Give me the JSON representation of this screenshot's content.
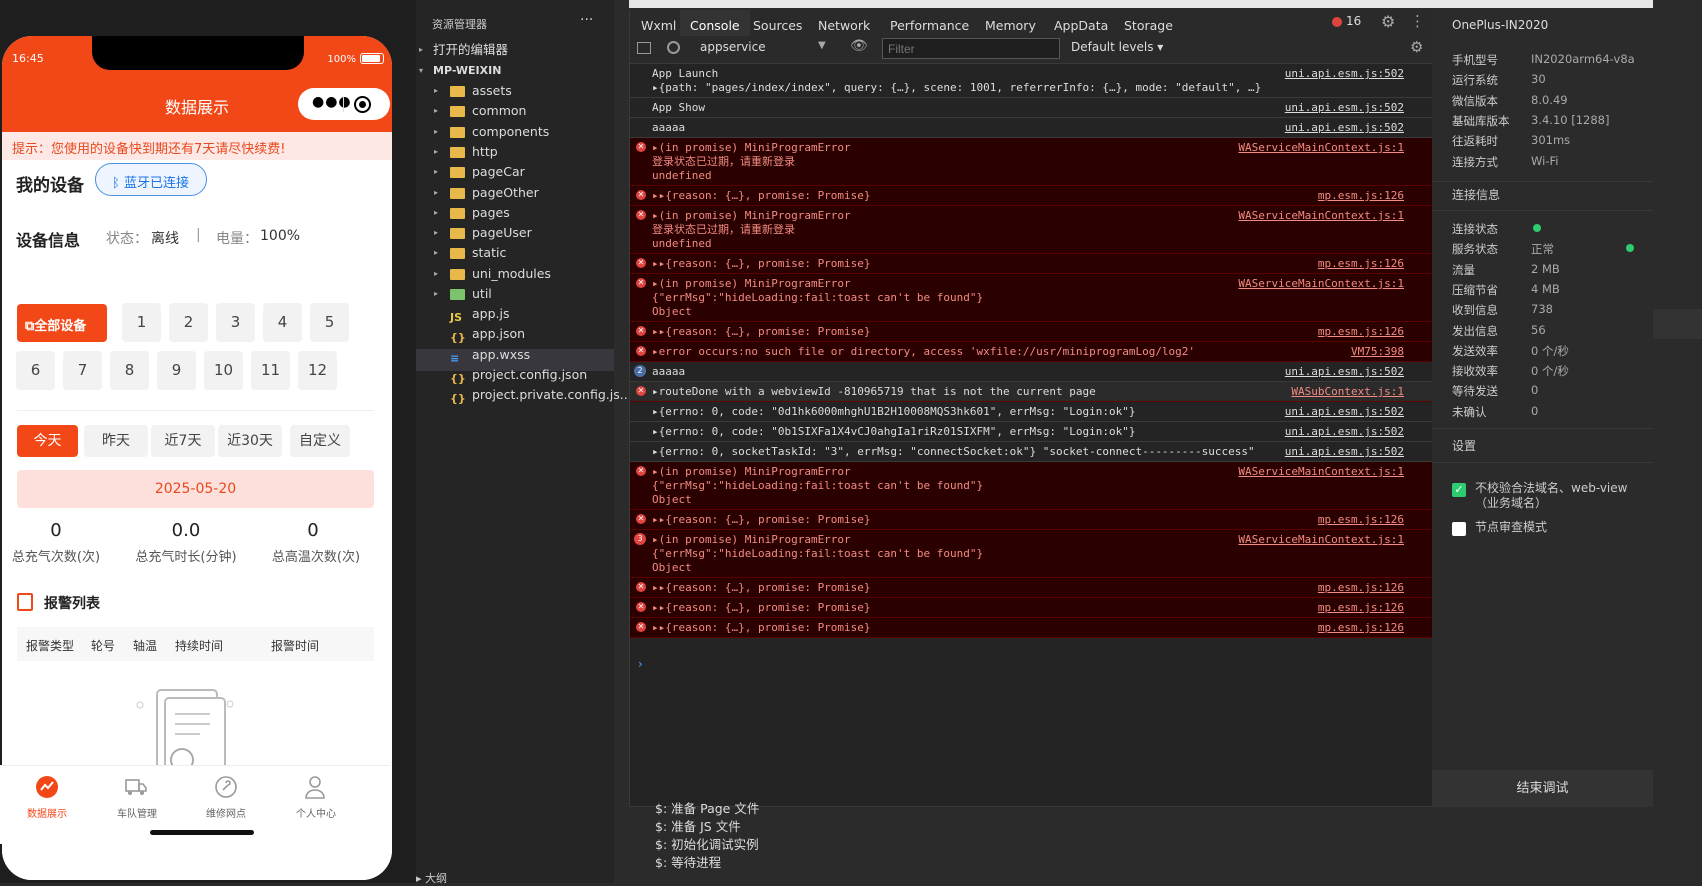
{
  "phone": {
    "time": "16:45",
    "battery": "100%",
    "title": "数据展示",
    "notice": "提示：您使用的设备快到期还有7天请尽快续费!",
    "my_devices": "我的设备",
    "bluetooth": "蓝牙已连接",
    "device_info": "设备信息",
    "status_label": "状态：",
    "status_value": "离线",
    "battery_label": "电量：",
    "battery_value": "100%",
    "all_devices": "全部设备",
    "device_numbers": [
      "1",
      "2",
      "3",
      "4",
      "5",
      "6",
      "7",
      "8",
      "9",
      "10",
      "11",
      "12"
    ],
    "ranges": [
      "今天",
      "昨天",
      "近7天",
      "近30天",
      "自定义"
    ],
    "date": "2025-05-20",
    "stats": [
      {
        "value": "0",
        "label": "总充气次数(次)"
      },
      {
        "value": "0.0",
        "label": "总充气时长(分钟)"
      },
      {
        "value": "0",
        "label": "总高温次数(次)"
      }
    ],
    "alarm_title": "报警列表",
    "alarm_cols": [
      "报警类型",
      "轮号",
      "轴温",
      "持续时间",
      "报警时间"
    ],
    "tabs": [
      "数据展示",
      "车队管理",
      "维修网点",
      "个人中心"
    ]
  },
  "explorer": {
    "title": "资源管理器",
    "more": "···",
    "open_editors": "打开的编辑器",
    "project": "MP-WEIXIN",
    "folders": [
      "assets",
      "common",
      "components",
      "http",
      "pageCar",
      "pageOther",
      "pages",
      "pageUser",
      "static",
      "uni_modules",
      "util"
    ],
    "files": [
      "app.js",
      "app.json",
      "app.wxss",
      "project.config.json",
      "project.private.config.js..."
    ],
    "bottom": "大纲"
  },
  "devtools": {
    "tabs": [
      "Wxml",
      "Console",
      "Sources",
      "Network",
      "Performance",
      "Memory",
      "AppData",
      "Storage"
    ],
    "error_count": "16",
    "context": "appservice",
    "filter_placeholder": "Filter",
    "levels": "Default levels",
    "rows": [
      {
        "type": "log",
        "msg": "App Launch\n▸{path: \"pages/index/index\", query: {…}, scene: 1001, referrerInfo: {…}, mode: \"default\", …}",
        "src": "uni.api.esm.js:502"
      },
      {
        "type": "log",
        "msg": "App Show",
        "src": "uni.api.esm.js:502"
      },
      {
        "type": "log",
        "msg": "aaaaa",
        "src": "uni.api.esm.js:502"
      },
      {
        "type": "err",
        "msg": "▸(in promise) MiniProgramError\n登录状态已过期，请重新登录\nundefined",
        "src": "WAServiceMainContext.js:1"
      },
      {
        "type": "err",
        "msg": "▸▸{reason: {…}, promise: Promise}",
        "src": "mp.esm.js:126"
      },
      {
        "type": "err",
        "msg": "▸(in promise) MiniProgramError\n登录状态已过期，请重新登录\nundefined",
        "src": "WAServiceMainContext.js:1"
      },
      {
        "type": "err",
        "msg": "▸▸{reason: {…}, promise: Promise}",
        "src": "mp.esm.js:126"
      },
      {
        "type": "err",
        "msg": "▸(in promise) MiniProgramError\n{\"errMsg\":\"hideLoading:fail:toast can't be found\"}\nObject",
        "src": "WAServiceMainContext.js:1"
      },
      {
        "type": "err",
        "msg": "▸▸{reason: {…}, promise: Promise}",
        "src": "mp.esm.js:126"
      },
      {
        "type": "err",
        "msg": "▸error occurs:no such file or directory, access 'wxfile://usr/miniprogramLog/log2'",
        "src": "VM75:398"
      },
      {
        "type": "log",
        "msg": "aaaaa",
        "src": "uni.api.esm.js:502",
        "count": "2"
      },
      {
        "type": "errlight",
        "msg": "▸routeDone with a webviewId -810965719 that is not the current page",
        "src": "WASubContext.js:1"
      },
      {
        "type": "log",
        "msg": "▸{errno: 0, code: \"0d1hk6000mhghU1B2H10008MQS3hk601\", errMsg: \"Login:ok\"}",
        "src": "uni.api.esm.js:502"
      },
      {
        "type": "log",
        "msg": "▸{errno: 0, code: \"0b1SIXFa1X4vCJ0ahgIa1riRz01SIXFM\", errMsg: \"Login:ok\"}",
        "src": "uni.api.esm.js:502"
      },
      {
        "type": "log",
        "msg": "▸{errno: 0, socketTaskId: \"3\", errMsg: \"connectSocket:ok\"} \"socket-connect---------success\"",
        "src": "uni.api.esm.js:502"
      },
      {
        "type": "err",
        "msg": "▸(in promise) MiniProgramError\n{\"errMsg\":\"hideLoading:fail:toast can't be found\"}\nObject",
        "src": "WAServiceMainContext.js:1"
      },
      {
        "type": "err",
        "msg": "▸▸{reason: {…}, promise: Promise}",
        "src": "mp.esm.js:126"
      },
      {
        "type": "err",
        "msg": "▸(in promise) MiniProgramError\n{\"errMsg\":\"hideLoading:fail:toast can't be found\"}\nObject",
        "src": "WAServiceMainContext.js:1",
        "count": "3"
      },
      {
        "type": "err",
        "msg": "▸▸{reason: {…}, promise: Promise}",
        "src": "mp.esm.js:126"
      },
      {
        "type": "err",
        "msg": "▸▸{reason: {…}, promise: Promise}",
        "src": "mp.esm.js:126"
      },
      {
        "type": "err",
        "msg": "▸▸{reason: {…}, promise: Promise}",
        "src": "mp.esm.js:126"
      }
    ],
    "prompt": "›"
  },
  "device_panel": {
    "name": "OnePlus-IN2020",
    "info": [
      {
        "k": "手机型号",
        "v": "IN2020arm64-v8a"
      },
      {
        "k": "运行系统",
        "v": "30"
      },
      {
        "k": "微信版本",
        "v": "8.0.49"
      },
      {
        "k": "基础库版本",
        "v": "3.4.10 [1288]"
      },
      {
        "k": "往返耗时",
        "v": "301ms"
      },
      {
        "k": "连接方式",
        "v": "Wi-Fi"
      }
    ],
    "conn_title": "连接信息",
    "conn": [
      {
        "k": "连接状态",
        "v": ""
      },
      {
        "k": "服务状态",
        "v": "正常"
      },
      {
        "k": "流量",
        "v": "2 MB"
      },
      {
        "k": "压缩节省",
        "v": "4 MB"
      },
      {
        "k": "收到信息",
        "v": "738"
      },
      {
        "k": "发出信息",
        "v": "56"
      },
      {
        "k": "发送效率",
        "v": "0 个/秒"
      },
      {
        "k": "接收效率",
        "v": "0 个/秒"
      },
      {
        "k": "等待发送",
        "v": "0"
      },
      {
        "k": "未确认",
        "v": "0"
      }
    ],
    "settings_title": "设置",
    "opt1": "不校验合法域名、web-view（业务域名）",
    "opt2": "节点审查模式",
    "end": "结束调试",
    "colors": {
      "ok": "#2ecc71",
      "checkbox": "#2ecc71"
    }
  },
  "terminal": [
    "$: 准备 Page 文件",
    "$: 准备 JS 文件",
    "$: 初始化调试实例",
    "$: 等待进程"
  ],
  "colors": {
    "brand": "#f24818",
    "error_bg": "#2b0000"
  }
}
